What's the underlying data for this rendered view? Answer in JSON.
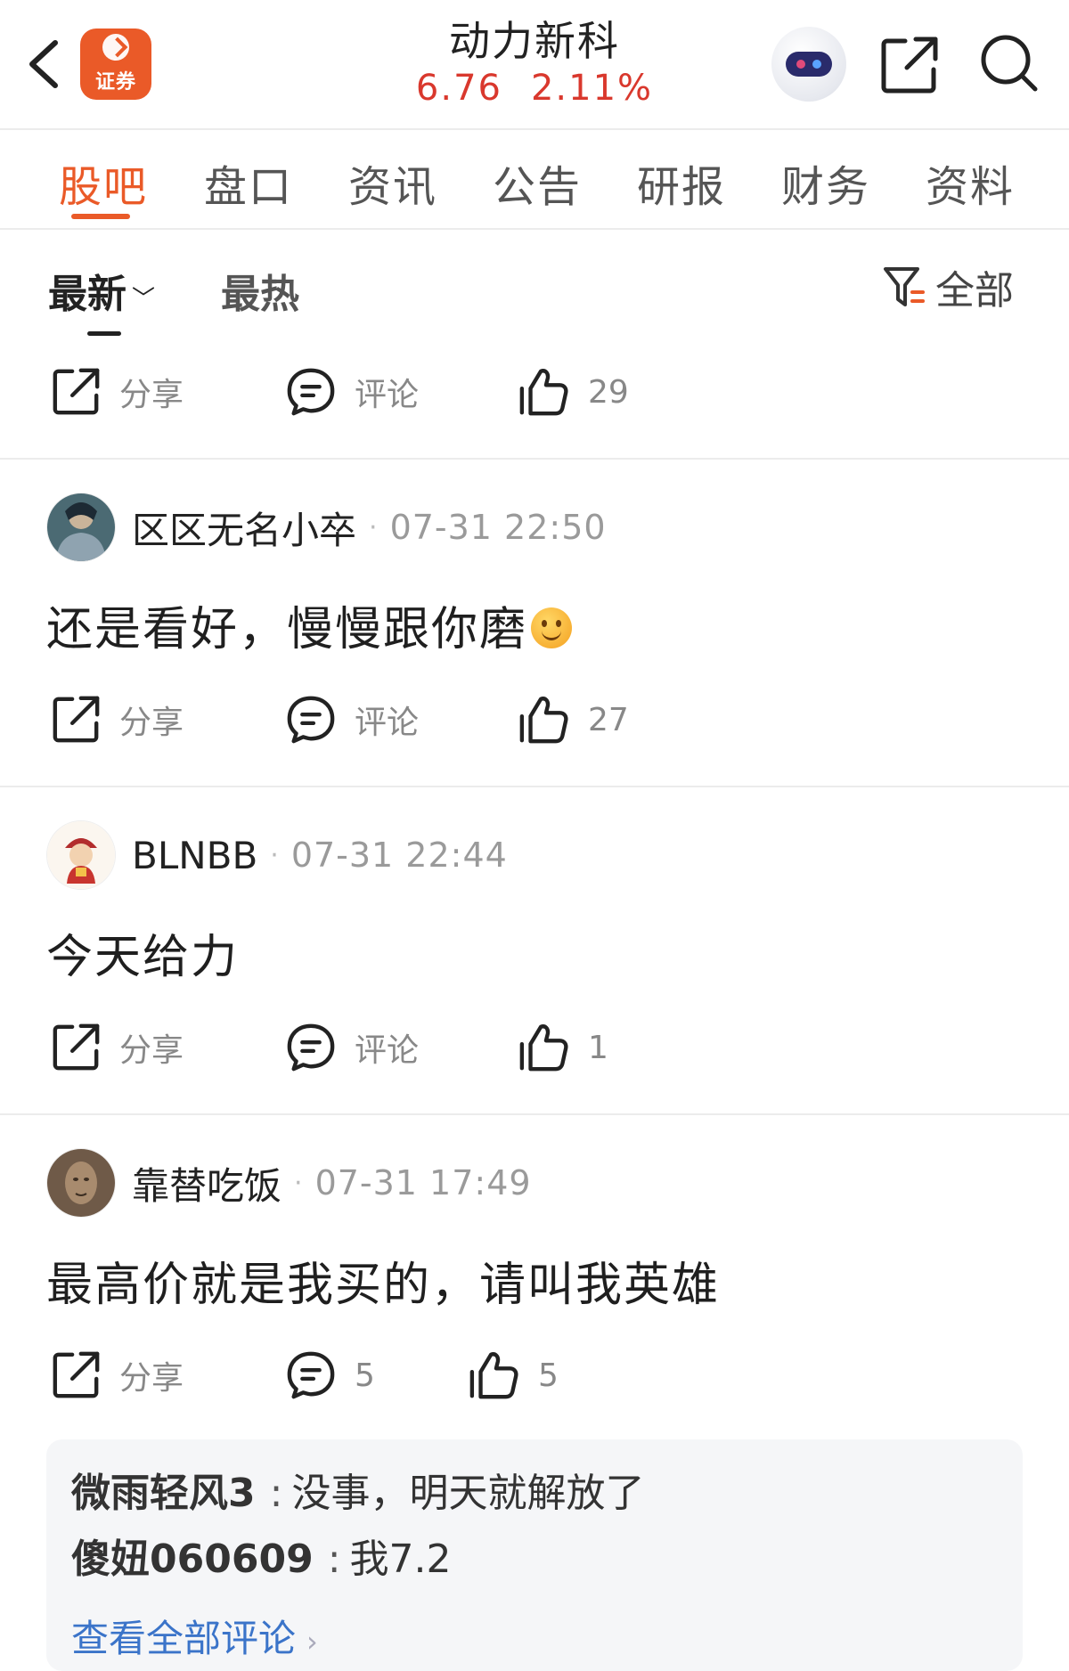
{
  "header": {
    "logo_text": "证券",
    "stock_name": "动力新科",
    "price": "6.76",
    "change_pct": "2.11%"
  },
  "tabs": [
    {
      "label": "股吧"
    },
    {
      "label": "盘口"
    },
    {
      "label": "资讯"
    },
    {
      "label": "公告"
    },
    {
      "label": "研报"
    },
    {
      "label": "财务"
    },
    {
      "label": "资料"
    }
  ],
  "active_tab": "股吧",
  "sort": {
    "newest": "最新",
    "hottest": "最热",
    "filter_label": "全部"
  },
  "action_labels": {
    "share": "分享",
    "comment": "评论"
  },
  "top_post_actions": {
    "likes": "29"
  },
  "posts": [
    {
      "user": "区区无名小卒",
      "time": "07-31 22:50",
      "content": "还是看好，慢慢跟你磨",
      "emoji": "smile-emoji",
      "likes": "27"
    },
    {
      "user": "BLNBB",
      "time": "07-31 22:44",
      "content": "今天给力",
      "likes": "1"
    },
    {
      "user": "靠替吃饭",
      "time": "07-31 17:49",
      "content": "最高价就是我买的，请叫我英雄",
      "comments": "5",
      "likes": "5",
      "replies": [
        {
          "user": "微雨轻风3",
          "text": "没事，明天就解放了"
        },
        {
          "user": "傻妞060609",
          "text": "我7.2"
        }
      ],
      "view_all": "查看全部评论"
    }
  ],
  "colors": {
    "accent": "#ea5a28",
    "price_up": "#d9382d",
    "link": "#3b74c9"
  }
}
